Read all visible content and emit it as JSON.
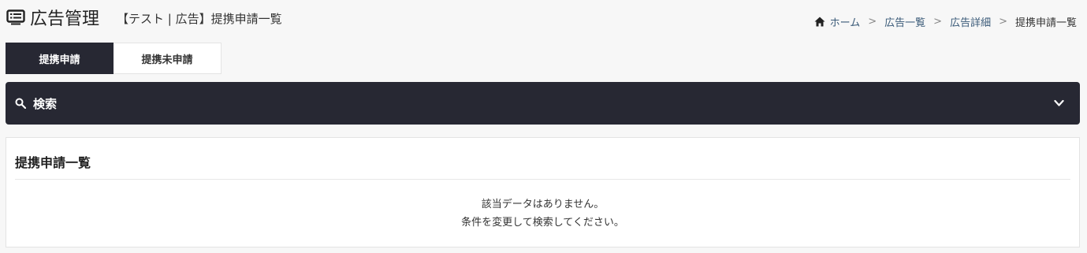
{
  "header": {
    "title": "広告管理",
    "subtitle": "【テスト | 広告】提携申請一覧",
    "icon": "list-box-icon"
  },
  "breadcrumb": {
    "home": "ホーム",
    "items": [
      "広告一覧",
      "広告詳細"
    ],
    "current": "提携申請一覧",
    "separator": ">"
  },
  "tabs": [
    {
      "label": "提携申請",
      "active": true
    },
    {
      "label": "提携未申請",
      "active": false
    }
  ],
  "search": {
    "label": "検索",
    "icon": "search-icon",
    "toggle_icon": "chevron-down-icon"
  },
  "list": {
    "title": "提携申請一覧",
    "empty_line1": "該当データはありません。",
    "empty_line2": "条件を変更して検索してください。"
  },
  "colors": {
    "dark": "#272833",
    "link": "#3a5a78",
    "background": "#f7f7f7"
  }
}
